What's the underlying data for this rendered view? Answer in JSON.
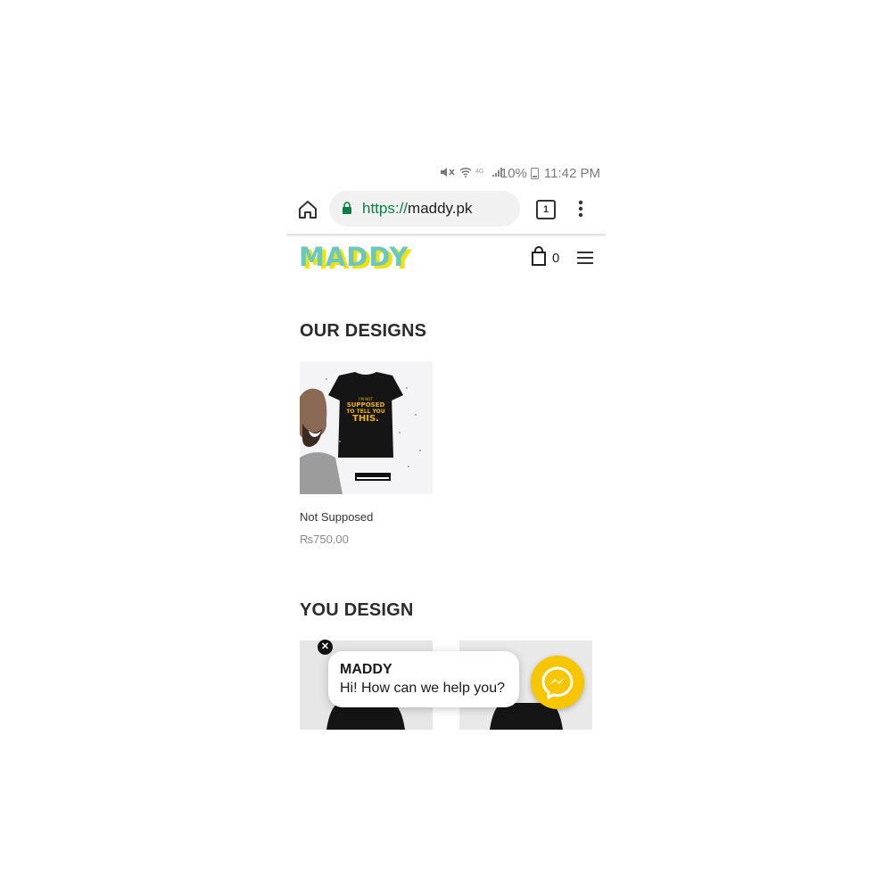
{
  "status_bar": {
    "battery": "10%",
    "time": "11:42 PM",
    "icons": [
      "mute-icon",
      "wifi-icon",
      "4g-icon",
      "signal-icon",
      "battery-icon"
    ]
  },
  "browser": {
    "url_scheme": "https://",
    "url_host": "maddy.pk",
    "tab_count": "1",
    "icons": [
      "home-icon",
      "lock-icon",
      "tabs-icon",
      "overflow-menu-icon"
    ]
  },
  "header": {
    "logo_text": "MADDY",
    "cart_count": "0",
    "icons": [
      "cart-icon",
      "hamburger-menu-icon"
    ]
  },
  "sections": {
    "our_designs": {
      "title": "OUR DESIGNS",
      "products": [
        {
          "name": "Not Supposed",
          "price": "₨750.00",
          "shirt_text": [
            "I'M NOT",
            "SUPPOSED",
            "TO TELL YOU",
            "THIS."
          ]
        }
      ]
    },
    "you_design": {
      "title": "YOU DESIGN"
    }
  },
  "chat_widget": {
    "sender": "MADDY",
    "message": "Hi! How can we help you?",
    "icons": [
      "close-icon",
      "messenger-icon"
    ]
  },
  "colors": {
    "logo_teal": "#6cc7c0",
    "logo_yellow": "#f2e200",
    "messenger_yellow": "#f7c600",
    "secure_green": "#0b8043"
  }
}
